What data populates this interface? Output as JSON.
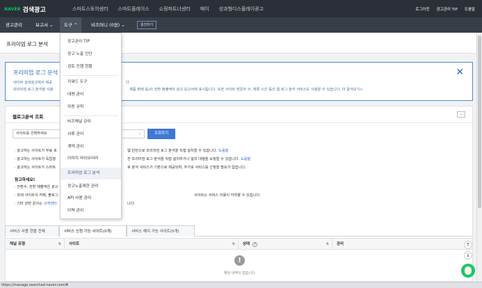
{
  "brand": {
    "naver": "NAVER",
    "name": "검색광고"
  },
  "topnav": [
    "스마트스토어센터",
    "스마트플레이스",
    "쇼핑파트너센터",
    "페이",
    "성과형디스플레이광고"
  ],
  "topright": [
    "로그아웃",
    "광고관리 TIP",
    "도움말"
  ],
  "nav": {
    "items": [
      "광고관리",
      "보고서 ⌄",
      "도구 ⌃",
      "비즈머니 (0원) ⌄"
    ],
    "charge_button": "충전하기"
  },
  "page": {
    "title": "프리미엄 로그 분석"
  },
  "notice": {
    "title": "프리미엄 로그 분석",
    "line1": "네이버 검색광고에서 제공",
    "line1_end": "다.",
    "line2": "프리미엄 로그 분석을 사용",
    "line2_end": "제품 판매 등)의 전환 매출액의 광고 보고서에 표시됩니다. 또한 사이트 방문자 수, 체류 시간 등의 웹 로그 분석 서비스도 사용할 수 있습니다. 더 알아보기>"
  },
  "panel": {
    "title": "웹로그분석 조회",
    "select": "사이트를 선택하세요",
    "search_button": "조회하기",
    "guides": [
      {
        "a": "· 광고하는 사이트가 무료 호",
        "b": "웹 빈만으로 프리미엄 로그 분석을 직접 설치할 수 있습니다.",
        "link": "도움말"
      },
      {
        "a": "· 광고하는 사이트가 독립형",
        "b": "전 프리미엄 로그 분석을 직접 설치하거나 설치 대행을 요청할 수 있습니다.",
        "link": "도움말"
      },
      {
        "a": "· 광고하는 사이트가 스마트",
        "b": "로 분석 서비스가 기본으로 제공되며, 추가로 서비스를 신청할 필요가 없습니다.",
        "link": ""
      }
    ],
    "caution_title": "참고하세요!",
    "cautions": [
      {
        "a": "· 전환수, 전환 매출액은 광고",
        "b": "",
        "link": ""
      },
      {
        "a": "· 프레 사이트의 카페, 블로그",
        "b": "사이트는 서비스 이용이 어려울 수 있습니다.",
        "link": ""
      },
      {
        "a": "· 기타 관련 문의는 ",
        "b": "니다.",
        "link": "고객센터"
      }
    ]
  },
  "tabs": [
    "서비스 사용 현황 전체",
    "서비스 신청 가능 사이트(0개)",
    "서비스 해지 가능 사이트(0개)"
  ],
  "table": {
    "headers": [
      "채널 유형",
      "사이트",
      "상태",
      "관리"
    ],
    "status_help": "?",
    "empty_icon": "!",
    "empty_text": "해당 내역이 없습니다."
  },
  "dropdown": {
    "items": [
      "광고관리 TIP",
      "광고 노출 진단",
      "검토 진행 현황",
      "키워드 도구",
      "대량 관리",
      "자동 규칙",
      "비즈채널 관리",
      "서류 관리",
      "계약 관리",
      "이미지 라이브러리",
      "프리미엄 로그 분석",
      "광고노출제한 관리",
      "API 사용 관리",
      "이력 관리"
    ],
    "active_index": 10
  },
  "fab": {
    "up": "↑",
    "down": "↓"
  },
  "status_url": "https://manage.searchad.naver.com/#"
}
